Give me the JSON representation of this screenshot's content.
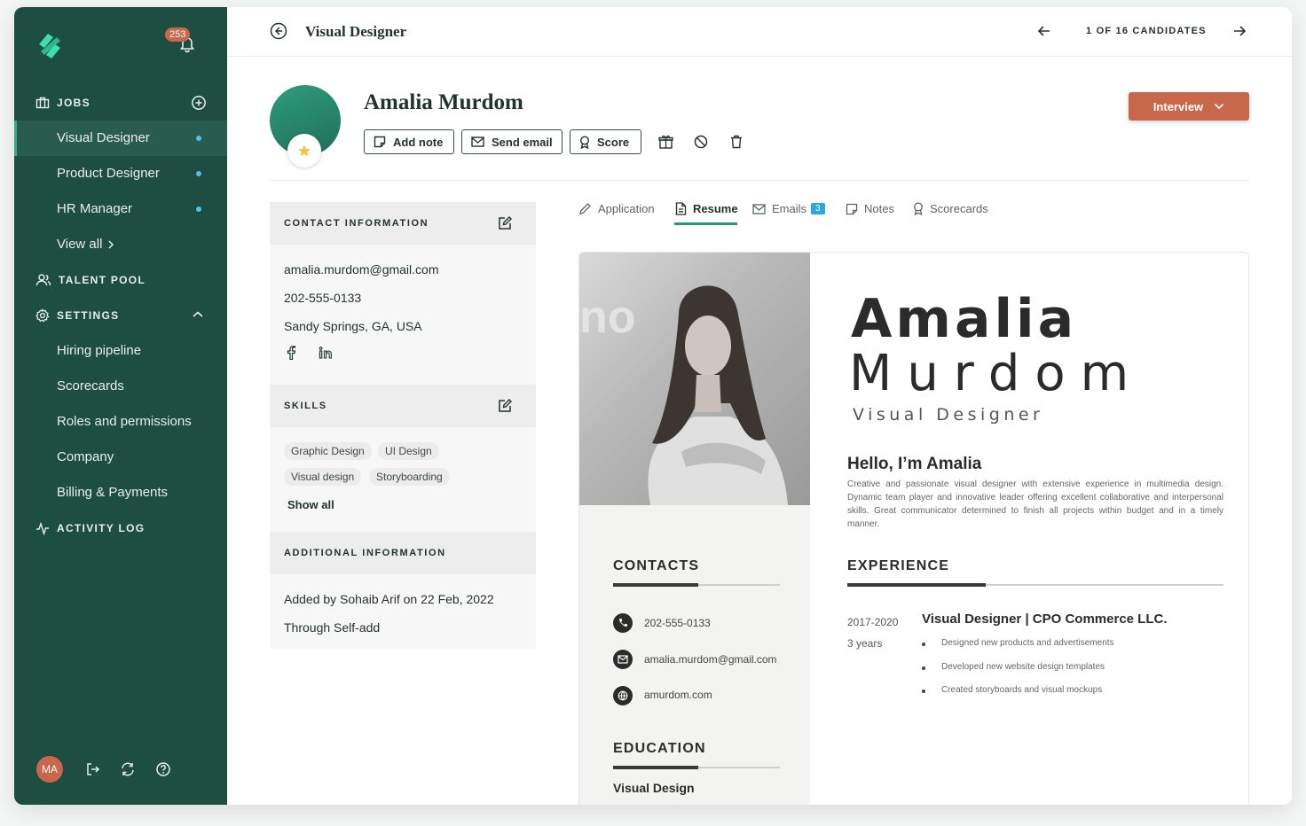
{
  "sidebar": {
    "notifications_count": "253",
    "jobs_label": "JOBS",
    "job_items": [
      {
        "label": "Visual Designer"
      },
      {
        "label": "Product Designer"
      },
      {
        "label": "HR Manager"
      }
    ],
    "view_all": "View all",
    "talent_pool": "TALENT POOL",
    "settings": "SETTINGS",
    "settings_items": [
      {
        "label": "Hiring pipeline"
      },
      {
        "label": "Scorecards"
      },
      {
        "label": "Roles and permissions"
      },
      {
        "label": "Company"
      },
      {
        "label": "Billing & Payments"
      }
    ],
    "activity_log": "ACTIVITY LOG",
    "user_initials": "MA"
  },
  "header": {
    "title": "Visual Designer",
    "candidate_counter": "1 OF 16 CANDIDATES"
  },
  "candidate": {
    "name": "Amalia Murdom",
    "actions": {
      "add_note": "Add note",
      "send_email": "Send email",
      "score": "Score"
    },
    "stage_button": "Interview"
  },
  "contact": {
    "heading": "CONTACT INFORMATION",
    "email": "amalia.murdom@gmail.com",
    "phone": "202-555-0133",
    "location": "Sandy Springs, GA, USA"
  },
  "skills": {
    "heading": "SKILLS",
    "items": [
      "Graphic Design",
      "UI Design",
      "Visual design",
      "Storyboarding"
    ],
    "show_all": "Show all"
  },
  "additional": {
    "heading": "ADDITIONAL INFORMATION",
    "added_by": "Added by Sohaib Arif on 22 Feb, 2022",
    "source": "Through Self-add"
  },
  "tabs": {
    "application": "Application",
    "resume": "Resume",
    "emails": "Emails",
    "emails_count": "3",
    "notes": "Notes",
    "scorecards": "Scorecards"
  },
  "resume": {
    "first_name": "Amalia",
    "last_name": "Murdom",
    "role": "Visual Designer",
    "hello": "Hello, I’m Amalia",
    "summary": "Creative and passionate visual designer with extensive experience in multimedia design. Dynamic team player and innovative leader offering excellent collaborative and interpersonal skills. Great communicator determined to finish all projects within budget and in a timely manner.",
    "contacts_heading": "CONTACTS",
    "contacts": {
      "phone": "202-555-0133",
      "email": "amalia.murdom@gmail.com",
      "web": "amurdom.com"
    },
    "education_heading": "EDUCATION",
    "education_title": "Visual Design",
    "experience_heading": "EXPERIENCE",
    "experience": {
      "dates": "2017-2020",
      "duration": "3 years",
      "title": "Visual Designer | CPO Commerce LLC.",
      "bullets": [
        "Designed new products and advertisements",
        "Developed new website design templates",
        "Created storyboards and visual mockups"
      ]
    },
    "photo_sign_text": "no"
  },
  "colors": {
    "sidebar": "#1e4d42",
    "accent": "#c9674b",
    "teal": "#1f9a80",
    "badge_blue": "#2aa7e0"
  }
}
